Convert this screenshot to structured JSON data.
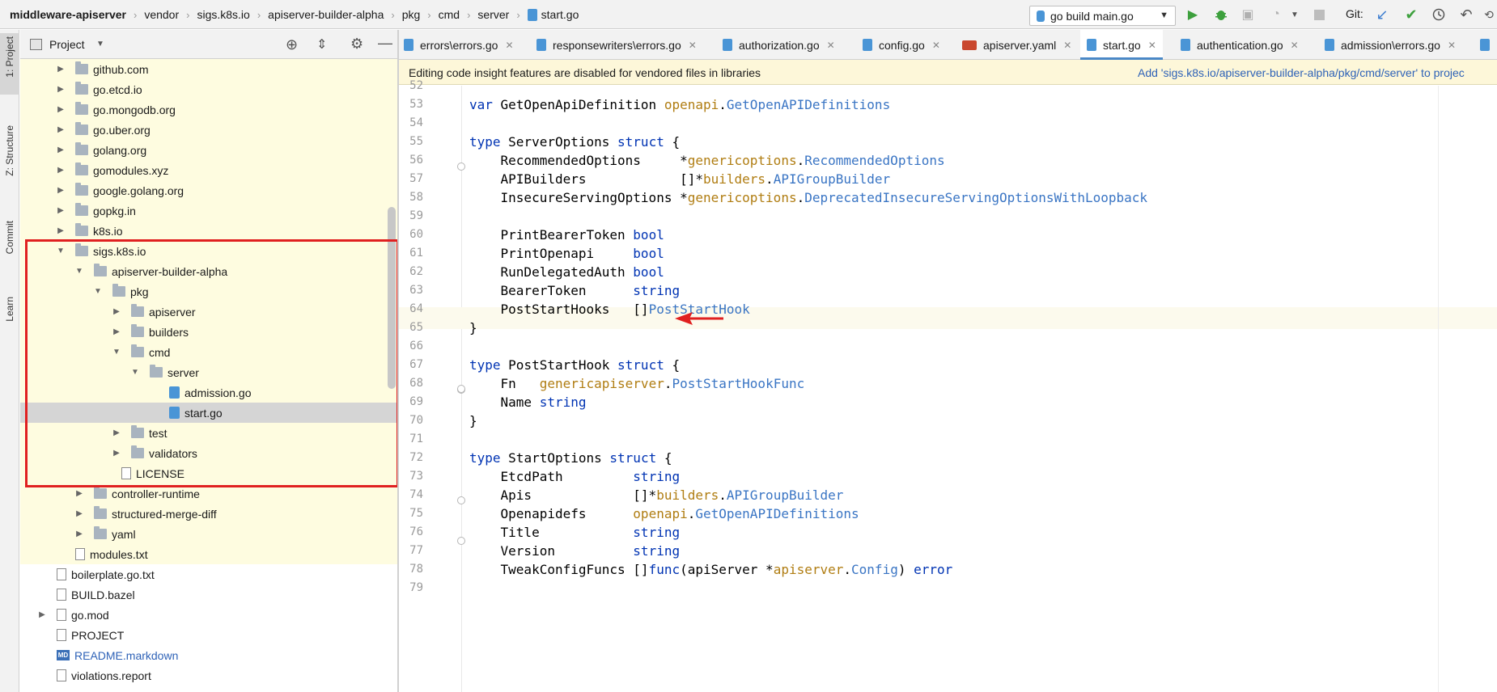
{
  "breadcrumbs": [
    "middleware-apiserver",
    "vendor",
    "sigs.k8s.io",
    "apiserver-builder-alpha",
    "pkg",
    "cmd",
    "server",
    "start.go"
  ],
  "toolbar": {
    "run_config": "go build main.go",
    "git_label": "Git:"
  },
  "tool_strip": {
    "project": "1: Project",
    "structure": "Z: Structure",
    "commit": "Commit",
    "learn": "Learn"
  },
  "project_panel": {
    "title": "Project",
    "tree": [
      {
        "label": "github.com",
        "type": "folder",
        "expanded": false
      },
      {
        "label": "go.etcd.io",
        "type": "folder",
        "expanded": false
      },
      {
        "label": "go.mongodb.org",
        "type": "folder",
        "expanded": false
      },
      {
        "label": "go.uber.org",
        "type": "folder",
        "expanded": false
      },
      {
        "label": "golang.org",
        "type": "folder",
        "expanded": false
      },
      {
        "label": "gomodules.xyz",
        "type": "folder",
        "expanded": false
      },
      {
        "label": "google.golang.org",
        "type": "folder",
        "expanded": false
      },
      {
        "label": "gopkg.in",
        "type": "folder",
        "expanded": false
      },
      {
        "label": "k8s.io",
        "type": "folder",
        "expanded": false
      },
      {
        "label": "sigs.k8s.io",
        "type": "folder",
        "expanded": true
      },
      {
        "label": "apiserver-builder-alpha",
        "type": "folder",
        "expanded": true
      },
      {
        "label": "pkg",
        "type": "folder",
        "expanded": true
      },
      {
        "label": "apiserver",
        "type": "folder",
        "expanded": false
      },
      {
        "label": "builders",
        "type": "folder",
        "expanded": false
      },
      {
        "label": "cmd",
        "type": "folder",
        "expanded": true
      },
      {
        "label": "server",
        "type": "folder",
        "expanded": true
      },
      {
        "label": "admission.go",
        "type": "go"
      },
      {
        "label": "start.go",
        "type": "go",
        "selected": true
      },
      {
        "label": "test",
        "type": "folder",
        "expanded": false
      },
      {
        "label": "validators",
        "type": "folder",
        "expanded": false
      },
      {
        "label": "LICENSE",
        "type": "text"
      },
      {
        "label": "controller-runtime",
        "type": "folder",
        "expanded": false
      },
      {
        "label": "structured-merge-diff",
        "type": "folder",
        "expanded": false
      },
      {
        "label": "yaml",
        "type": "folder",
        "expanded": false
      },
      {
        "label": "modules.txt",
        "type": "text"
      },
      {
        "label": "boilerplate.go.txt",
        "type": "text"
      },
      {
        "label": "BUILD.bazel",
        "type": "text"
      },
      {
        "label": "go.mod",
        "type": "text"
      },
      {
        "label": "PROJECT",
        "type": "text"
      },
      {
        "label": "README.markdown",
        "type": "md"
      },
      {
        "label": "violations.report",
        "type": "text"
      }
    ]
  },
  "editor_tabs": [
    {
      "label": "errors\\errors.go",
      "icon": "go-file-icon"
    },
    {
      "label": "responsewriters\\errors.go",
      "icon": "go-file-icon"
    },
    {
      "label": "authorization.go",
      "icon": "go-file-icon"
    },
    {
      "label": "config.go",
      "icon": "go-file-icon"
    },
    {
      "label": "apiserver.yaml",
      "icon": "yaml-file-icon"
    },
    {
      "label": "start.go",
      "icon": "go-file-icon",
      "active": true
    },
    {
      "label": "authentication.go",
      "icon": "go-file-icon"
    },
    {
      "label": "admission\\errors.go",
      "icon": "go-file-icon"
    }
  ],
  "notice": {
    "text": "Editing code insight features are disabled for vendored files in libraries",
    "action": "Add 'sigs.k8s.io/apiserver-builder-alpha/pkg/cmd/server' to projec"
  },
  "code_lines": [
    {
      "n": "52",
      "t": []
    },
    {
      "n": "53",
      "t": [
        [
          "kw",
          "var "
        ],
        [
          "",
          "GetOpenApiDefinition "
        ],
        [
          "pkg",
          "openapi"
        ],
        [
          "",
          "."
        ],
        [
          "ty",
          "GetOpenAPIDefinitions"
        ]
      ]
    },
    {
      "n": "54",
      "t": []
    },
    {
      "n": "55",
      "t": [
        [
          "kw",
          "type "
        ],
        [
          "",
          "ServerOptions "
        ],
        [
          "kw",
          "struct "
        ],
        [
          "",
          "{"
        ]
      ]
    },
    {
      "n": "56",
      "t": [
        [
          "",
          "    RecommendedOptions     *"
        ],
        [
          "pkg",
          "genericoptions"
        ],
        [
          "",
          "."
        ],
        [
          "ty",
          "RecommendedOptions"
        ]
      ]
    },
    {
      "n": "57",
      "t": [
        [
          "",
          "    APIBuilders            []*"
        ],
        [
          "pkg",
          "builders"
        ],
        [
          "",
          "."
        ],
        [
          "ty",
          "APIGroupBuilder"
        ]
      ]
    },
    {
      "n": "58",
      "t": [
        [
          "",
          "    InsecureServingOptions *"
        ],
        [
          "pkg",
          "genericoptions"
        ],
        [
          "",
          "."
        ],
        [
          "ty",
          "DeprecatedInsecureServingOptionsWithLoopback"
        ]
      ]
    },
    {
      "n": "59",
      "t": []
    },
    {
      "n": "60",
      "t": [
        [
          "",
          "    PrintBearerToken "
        ],
        [
          "kw",
          "bool"
        ]
      ]
    },
    {
      "n": "61",
      "t": [
        [
          "",
          "    PrintOpenapi     "
        ],
        [
          "kw",
          "bool"
        ]
      ]
    },
    {
      "n": "62",
      "t": [
        [
          "",
          "    RunDelegatedAuth "
        ],
        [
          "kw",
          "bool"
        ]
      ]
    },
    {
      "n": "63",
      "t": [
        [
          "",
          "    BearerToken      "
        ],
        [
          "kw",
          "string"
        ]
      ]
    },
    {
      "n": "64",
      "t": [
        [
          "",
          "    PostStartHooks   []"
        ],
        [
          "ty",
          "PostStartHook"
        ]
      ]
    },
    {
      "n": "65",
      "t": [
        [
          "",
          "}"
        ]
      ]
    },
    {
      "n": "66",
      "t": []
    },
    {
      "n": "67",
      "t": [
        [
          "kw",
          "type "
        ],
        [
          "",
          "PostStartHook "
        ],
        [
          "kw",
          "struct "
        ],
        [
          "",
          "{"
        ]
      ]
    },
    {
      "n": "68",
      "t": [
        [
          "",
          "    Fn   "
        ],
        [
          "pkg",
          "genericapiserver"
        ],
        [
          "",
          "."
        ],
        [
          "ty",
          "PostStartHookFunc"
        ]
      ]
    },
    {
      "n": "69",
      "t": [
        [
          "",
          "    Name "
        ],
        [
          "kw",
          "string"
        ]
      ]
    },
    {
      "n": "70",
      "t": [
        [
          "",
          "}"
        ]
      ]
    },
    {
      "n": "71",
      "t": []
    },
    {
      "n": "72",
      "t": [
        [
          "kw",
          "type "
        ],
        [
          "",
          "StartOptions "
        ],
        [
          "kw",
          "struct "
        ],
        [
          "",
          "{"
        ]
      ]
    },
    {
      "n": "73",
      "t": [
        [
          "",
          "    EtcdPath         "
        ],
        [
          "kw",
          "string"
        ]
      ]
    },
    {
      "n": "74",
      "t": [
        [
          "",
          "    Apis             []*"
        ],
        [
          "pkg",
          "builders"
        ],
        [
          "",
          "."
        ],
        [
          "ty",
          "APIGroupBuilder"
        ]
      ]
    },
    {
      "n": "75",
      "t": [
        [
          "",
          "    Openapidefs      "
        ],
        [
          "pkg",
          "openapi"
        ],
        [
          "",
          "."
        ],
        [
          "ty",
          "GetOpenAPIDefinitions"
        ]
      ]
    },
    {
      "n": "76",
      "t": [
        [
          "",
          "    Title            "
        ],
        [
          "kw",
          "string"
        ]
      ]
    },
    {
      "n": "77",
      "t": [
        [
          "",
          "    Version          "
        ],
        [
          "kw",
          "string"
        ]
      ]
    },
    {
      "n": "78",
      "t": [
        [
          "",
          "    TweakConfigFuncs []"
        ],
        [
          "kw",
          "func"
        ],
        [
          "",
          "(apiServer *"
        ],
        [
          "pkg",
          "apiserver"
        ],
        [
          "",
          "."
        ],
        [
          "ty",
          "Config"
        ],
        [
          "",
          ") "
        ],
        [
          "kw",
          "error"
        ]
      ]
    },
    {
      "n": "79",
      "t": []
    }
  ],
  "colors": {
    "accent": "#4a88c7",
    "annotation_red": "#e02020",
    "library_bg": "#fefce0"
  }
}
